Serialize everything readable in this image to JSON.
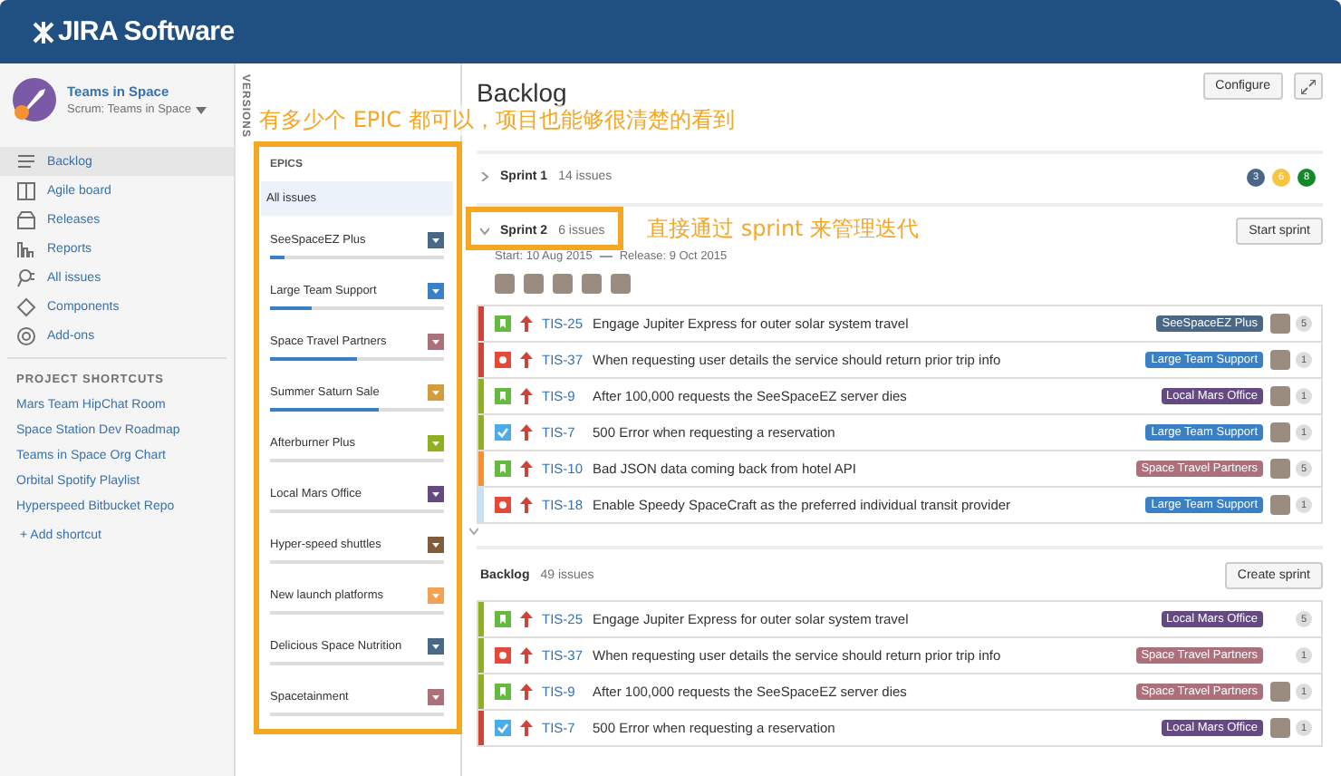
{
  "header": {
    "logo": "JIRA Software"
  },
  "project": {
    "name": "Teams in Space",
    "board": "Scrum: Teams in Space"
  },
  "nav": [
    {
      "label": "Backlog",
      "kind": "backlog",
      "selected": true
    },
    {
      "label": "Agile board",
      "kind": "board",
      "selected": false
    },
    {
      "label": "Releases",
      "kind": "releases",
      "selected": false
    },
    {
      "label": "Reports",
      "kind": "reports",
      "selected": false
    },
    {
      "label": "All issues",
      "kind": "issues",
      "selected": false
    },
    {
      "label": "Components",
      "kind": "components",
      "selected": false
    },
    {
      "label": "Add-ons",
      "kind": "addons",
      "selected": false
    }
  ],
  "shortcuts": {
    "title": "PROJECT SHORTCUTS",
    "items": [
      "Mars Team HipChat Room",
      "Space Station Dev Roadmap",
      "Teams in Space Org Chart",
      "Orbital Spotify Playlist",
      "Hyperspeed Bitbucket Repo"
    ],
    "add": "+ Add shortcut"
  },
  "versions_tab": "VERSIONS",
  "epics": {
    "title": "EPICS",
    "all": {
      "label": "All issues",
      "selected": true
    },
    "items": [
      {
        "name": "SeeSpaceEZ Plus",
        "color": "#4a6785",
        "level": 0.08
      },
      {
        "name": "Large Team Support",
        "color": "#3b7fc4",
        "level": 0.24
      },
      {
        "name": "Space Travel Partners",
        "color": "#ac707a",
        "level": 0.5
      },
      {
        "name": "Summer Saturn Sale",
        "color": "#d39c3f",
        "level": 0.62
      },
      {
        "name": "Afterburner Plus",
        "color": "#8eb021",
        "level": 0
      },
      {
        "name": "Local Mars Office",
        "color": "#654982",
        "level": 0
      },
      {
        "name": "Hyper-speed shuttles",
        "color": "#815b3a",
        "level": 0
      },
      {
        "name": "New launch platforms",
        "color": "#f1a257",
        "level": 0
      },
      {
        "name": "Delicious Space Nutrition",
        "color": "#4a6785",
        "level": 0
      },
      {
        "name": "Spacetainment",
        "color": "#ac707a",
        "level": 0
      }
    ]
  },
  "page": {
    "title": "Backlog",
    "configure": "Configure"
  },
  "sprints": [
    {
      "name": "Sprint 1",
      "count": "14 issues",
      "expanded": false,
      "badges": [
        {
          "value": "3",
          "color": "#4a6785"
        },
        {
          "value": "6",
          "color": "#f6c342"
        },
        {
          "value": "8",
          "color": "#14892c"
        }
      ]
    },
    {
      "name": "Sprint 2",
      "count": "6 issues",
      "expanded": true,
      "start": "Start: 10 Aug 2015",
      "release": "Release: 9 Oct 2015",
      "action": "Start sprint",
      "avatars": [
        {
          "kind": "photo"
        },
        {
          "kind": "photo"
        },
        {
          "kind": "photo"
        },
        {
          "kind": "photo"
        },
        {
          "kind": "photo"
        }
      ],
      "issues": [
        {
          "kind": "story",
          "flag": {
            "color": "#d04437"
          },
          "key": "TIS-25",
          "summary": "Engage Jupiter Express for outer solar system travel",
          "epic": {
            "label": "SeeSpaceEZ Plus",
            "color": "#4a6785"
          },
          "assignee": true,
          "estimate": "5"
        },
        {
          "kind": "bug",
          "flag": {
            "color": "#d04437"
          },
          "key": "TIS-37",
          "summary": "When requesting user details the service should return prior trip info",
          "epic": {
            "label": "Large Team Support",
            "color": "#3b7fc4"
          },
          "assignee": true,
          "estimate": "1"
        },
        {
          "kind": "story",
          "flag": {
            "color": "#8eb021"
          },
          "key": "TIS-9",
          "summary": "After 100,000 requests the SeeSpaceEZ server dies",
          "epic": {
            "label": "Local Mars Office",
            "color": "#654982"
          },
          "assignee": true,
          "estimate": "1"
        },
        {
          "kind": "task",
          "flag": {
            "color": "#8eb021"
          },
          "key": "TIS-7",
          "summary": "500 Error when requesting a reservation",
          "epic": {
            "label": "Large Team Support",
            "color": "#3b7fc4"
          },
          "assignee": true,
          "estimate": "1"
        },
        {
          "kind": "story",
          "flag": {
            "color": "#f79232"
          },
          "key": "TIS-10",
          "summary": "Bad JSON data coming back from hotel API",
          "epic": {
            "label": "Space Travel Partners",
            "color": "#ac707a"
          },
          "assignee": true,
          "estimate": "5"
        },
        {
          "kind": "bug",
          "flag": {
            "color": "#c8e1fb"
          },
          "key": "TIS-18",
          "summary": "Enable Speedy SpaceCraft as the preferred individual transit provider",
          "epic": {
            "label": "Large Team Support",
            "color": "#3b7fc4"
          },
          "assignee": true,
          "estimate": "1"
        }
      ]
    }
  ],
  "backlog": {
    "name": "Backlog",
    "count": "49 issues",
    "action": "Create sprint",
    "issues": [
      {
        "kind": "story",
        "flag": {
          "color": "#8eb021"
        },
        "key": "TIS-25",
        "summary": "Engage Jupiter Express for outer solar system travel",
        "epic": {
          "label": "Local Mars Office",
          "color": "#654982"
        },
        "assignee": false,
        "estimate": "5"
      },
      {
        "kind": "bug",
        "flag": {
          "color": "#8eb021"
        },
        "key": "TIS-37",
        "summary": "When requesting user details the service should return prior trip info",
        "epic": {
          "label": "Space Travel Partners",
          "color": "#ac707a"
        },
        "assignee": false,
        "estimate": "1"
      },
      {
        "kind": "story",
        "flag": {
          "color": "#8eb021"
        },
        "key": "TIS-9",
        "summary": "After 100,000 requests the SeeSpaceEZ server dies",
        "epic": {
          "label": "Space Travel Partners",
          "color": "#ac707a"
        },
        "assignee": true,
        "estimate": "1"
      },
      {
        "kind": "task",
        "flag": {
          "color": "#d04437"
        },
        "key": "TIS-7",
        "summary": "500 Error when requesting a reservation",
        "epic": {
          "label": "Local Mars Office",
          "color": "#654982"
        },
        "assignee": true,
        "estimate": "1"
      }
    ]
  },
  "annotations": [
    {
      "kind": "epics",
      "text": "有多少个 EPIC 都可以，项目也能够很清楚的看到"
    },
    {
      "kind": "sprint",
      "text": "直接通过 sprint 来管理迭代"
    }
  ]
}
